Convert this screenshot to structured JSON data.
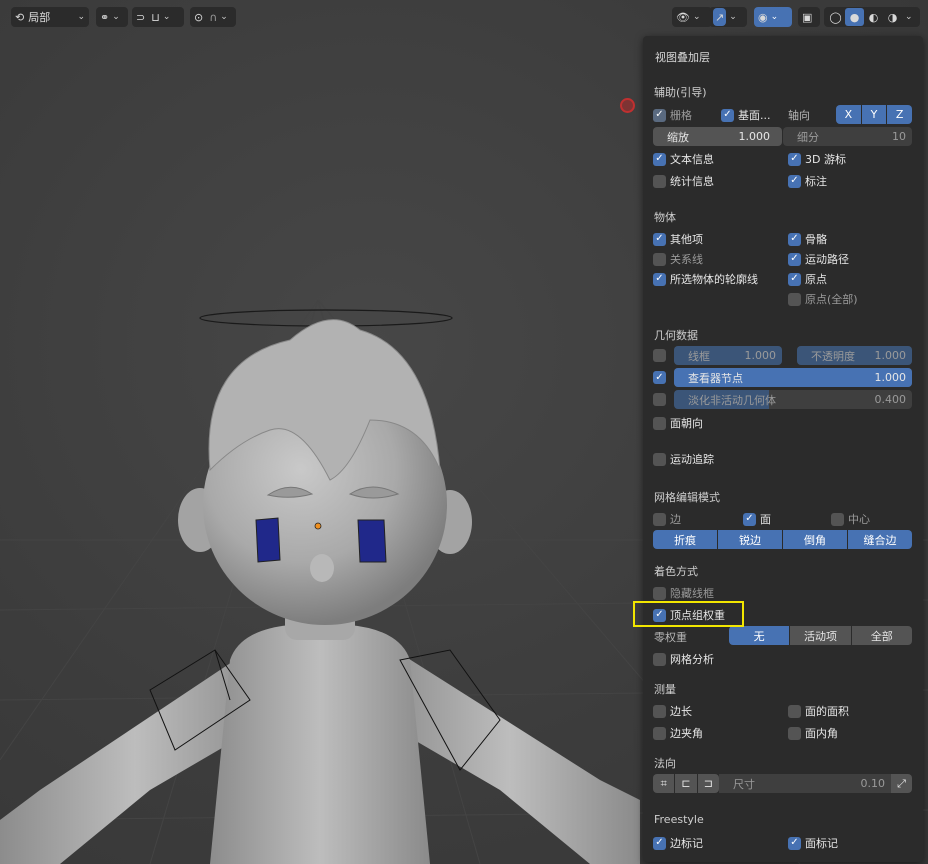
{
  "header": {
    "mode_label": "局部",
    "pivot_icon": "pivot-icon",
    "snap_icon": "magnet-icon",
    "proportional_icon": "proportional-icon",
    "visibility_icon": "eye-icon",
    "gizmo_icon": "gizmo-icon",
    "overlay_icon": "overlay-icon",
    "xray_icon": "xray-icon",
    "shading_icons": [
      "wireframe-icon",
      "solid-icon",
      "material-icon",
      "rendered-icon"
    ]
  },
  "panel": {
    "title": "视图叠加层",
    "guides": {
      "heading": "辅助(引导)",
      "grid": "栅格",
      "floor": "基面...",
      "axis_label": "轴向",
      "axes": [
        "X",
        "Y",
        "Z"
      ],
      "scale_label": "缩放",
      "scale_value": "1.000",
      "subdiv_label": "细分",
      "subdiv_value": "10",
      "text_info": "文本信息",
      "cursor_3d": "3D 游标",
      "stats": "统计信息",
      "annotations": "标注"
    },
    "objects": {
      "heading": "物体",
      "extras": "其他项",
      "bones": "骨骼",
      "relations": "关系线",
      "motion_paths": "运动路径",
      "outline_selected": "所选物体的轮廓线",
      "origins": "原点",
      "origins_all": "原点(全部)"
    },
    "geometry": {
      "heading": "几何数据",
      "wireframe_label": "线框",
      "wireframe_value": "1.000",
      "wireframe_fraction": 1.0,
      "opacity_label": "不透明度",
      "opacity_value": "1.000",
      "viewer_node_label": "查看器节点",
      "viewer_node_value": "1.000",
      "viewer_node_fraction": 1.0,
      "fade_label": "淡化非活动几何体",
      "fade_value": "0.400",
      "fade_fraction": 0.4,
      "face_orientation": "面朝向"
    },
    "motion_tracking": "运动追踪",
    "mesh_edit": {
      "heading": "网格编辑模式",
      "edges": "边",
      "faces": "面",
      "center": "中心",
      "buttons": [
        "折痕",
        "锐边",
        "倒角",
        "缝合边"
      ]
    },
    "shading": {
      "heading": "着色方式",
      "hidden_wire": "隐藏线框",
      "vertex_group_weights": "顶点组权重",
      "zero_weights_label": "零权重",
      "zero_weights_options": [
        "无",
        "活动项",
        "全部"
      ],
      "mesh_analysis": "网格分析"
    },
    "measurement": {
      "heading": "测量",
      "edge_length": "边长",
      "face_area": "面的面积",
      "edge_angle": "边夹角",
      "face_angle": "面内角"
    },
    "normals": {
      "heading": "法向",
      "size_label": "尺寸",
      "size_value": "0.10"
    },
    "freestyle": {
      "heading": "Freestyle",
      "edge_marks": "边标记",
      "face_marks": "面标记"
    }
  },
  "colors": {
    "accent": "#4772b3",
    "panel_bg": "#2b2b2b",
    "highlight": "#f2e600",
    "eye_blue": "#20288a"
  }
}
